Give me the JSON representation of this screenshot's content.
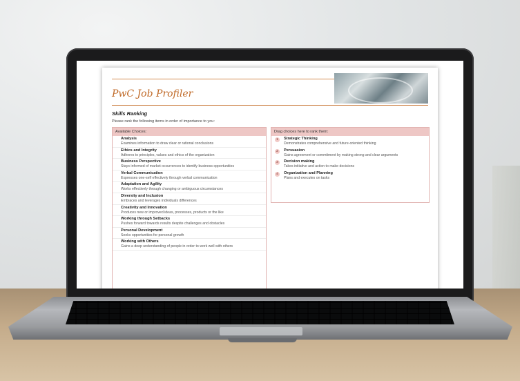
{
  "app": {
    "logo_text": "PwC Job Profiler"
  },
  "section": {
    "title": "Skills Ranking",
    "instructions": "Please rank the following items in order of importance to you:"
  },
  "available": {
    "header": "Available Choices:",
    "items": [
      {
        "name": "Analysis",
        "desc": "Examines information to draw clear or rational conclusions"
      },
      {
        "name": "Ethics and Integrity",
        "desc": "Adheres to principles, values and ethics of the organization"
      },
      {
        "name": "Business Perspective",
        "desc": "Stays informed of market occurrences to identify business opportunities"
      },
      {
        "name": "Verbal Communication",
        "desc": "Expresses one-self effectively through verbal communication"
      },
      {
        "name": "Adaptation and Agility",
        "desc": "Works effectively through changing or ambiguous circumstances"
      },
      {
        "name": "Diversity and Inclusion",
        "desc": "Embraces and leverages individuals differences"
      },
      {
        "name": "Creativity and Innovation",
        "desc": "Produces new or improved ideas, processes, products or the like"
      },
      {
        "name": "Working through Setbacks",
        "desc": "Pushes forward towards results despite challenges and obstacles"
      },
      {
        "name": "Personal Development",
        "desc": "Seeks opportunities for personal growth"
      },
      {
        "name": "Working with Others",
        "desc": "Gains a deep understanding of people in order to work well with others"
      }
    ]
  },
  "ranked": {
    "header": "Drag choices here to rank them:",
    "items": [
      {
        "num": "1",
        "name": "Strategic Thinking",
        "desc": "Demonstrates comprehensive and future-oriented thinking"
      },
      {
        "num": "2",
        "name": "Persuasion",
        "desc": "Gains agreement or commitment by making strong and clear arguments"
      },
      {
        "num": "3",
        "name": "Decision making",
        "desc": "Takes initiative and action to make decisions"
      },
      {
        "num": "4",
        "name": "Organization and Planning",
        "desc": "Plans and executes on tasks"
      }
    ]
  }
}
